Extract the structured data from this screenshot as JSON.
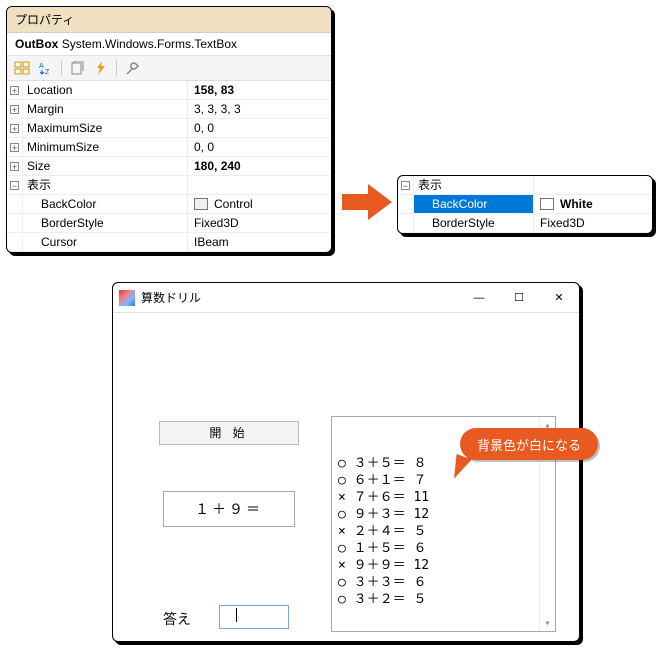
{
  "props_left": {
    "header": "プロパティ",
    "selector_name": "OutBox",
    "selector_type": "System.Windows.Forms.TextBox",
    "rows": [
      {
        "exp": "+",
        "name": "Location",
        "val": "158, 83",
        "bold": true
      },
      {
        "exp": "+",
        "name": "Margin",
        "val": "3, 3, 3, 3"
      },
      {
        "exp": "+",
        "name": "MaximumSize",
        "val": "0, 0"
      },
      {
        "exp": "+",
        "name": "MinimumSize",
        "val": "0, 0"
      },
      {
        "exp": "+",
        "name": "Size",
        "val": "180, 240",
        "bold": true
      },
      {
        "exp": "−",
        "name": "表示",
        "val": ""
      },
      {
        "exp": "",
        "name": "BackColor",
        "val": "Control",
        "swatch": "control",
        "child": true
      },
      {
        "exp": "",
        "name": "BorderStyle",
        "val": "Fixed3D",
        "child": true
      },
      {
        "exp": "",
        "name": "Cursor",
        "val": "IBeam",
        "child": true
      }
    ]
  },
  "props_right": {
    "rows": [
      {
        "exp": "−",
        "name": "表示",
        "val": ""
      },
      {
        "exp": "",
        "name": "BackColor",
        "val": "White",
        "swatch": "white",
        "child": true,
        "selected": true,
        "bold": true
      },
      {
        "exp": "",
        "name": "BorderStyle",
        "val": "Fixed3D",
        "child": true
      }
    ]
  },
  "app": {
    "title": "算数ドリル",
    "start_label": "開 始",
    "question": "１＋９＝",
    "answer_label": "答え",
    "results": [
      "○ ３＋５＝ ８",
      "○ ６＋１＝ ７",
      "× ７＋６＝ 11",
      "○ ９＋３＝ 12",
      "× ２＋４＝ ５",
      "○ １＋５＝ ６",
      "× ９＋９＝ 12",
      "○ ３＋３＝ ６",
      "○ ３＋２＝ ５"
    ]
  },
  "callout": "背景色が白になる"
}
